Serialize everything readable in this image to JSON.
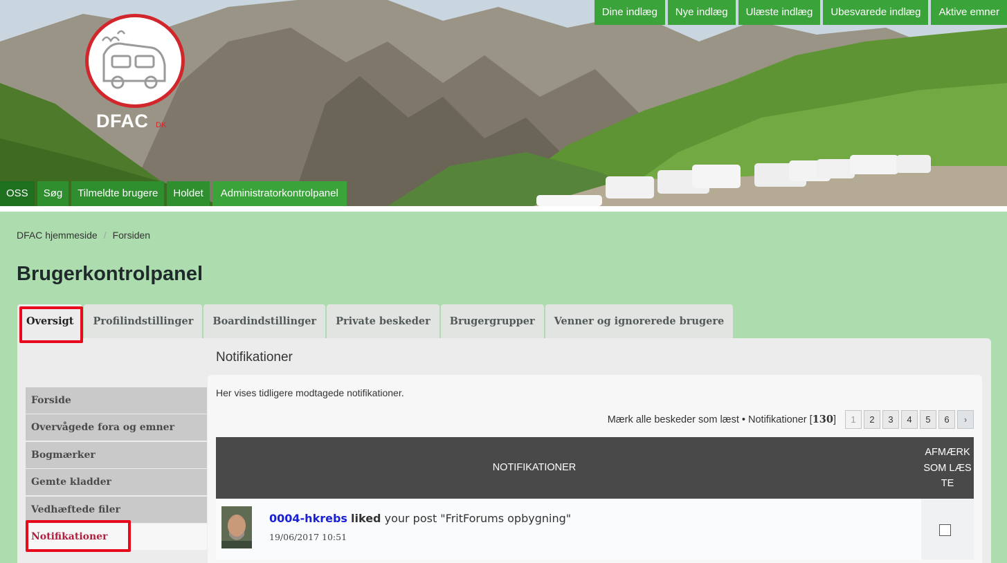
{
  "header": {
    "logo_text": "DFAC",
    "logo_sub": "DK",
    "top_nav": [
      "Dine indlæg",
      "Nye indlæg",
      "Ulæste indlæg",
      "Ubesvarede indlæg",
      "Aktive emner"
    ],
    "bottom_nav": [
      "OSS",
      "Søg",
      "Tilmeldte brugere",
      "Holdet",
      "Administratorkontrolpanel"
    ]
  },
  "breadcrumb": [
    "DFAC hjemmeside",
    "Forsiden"
  ],
  "page_title": "Brugerkontrolpanel",
  "tabs": [
    "Oversigt",
    "Profilindstillinger",
    "Boardindstillinger",
    "Private beskeder",
    "Brugergrupper",
    "Venner og ignorerede brugere"
  ],
  "active_tab": "Oversigt",
  "side_menu": [
    "Forside",
    "Overvågede fora og emner",
    "Bogmærker",
    "Gemte kladder",
    "Vedhæftede filer",
    "Notifikationer"
  ],
  "active_side_item": "Notifikationer",
  "section": {
    "title": "Notifikationer",
    "description": "Her vises tidligere modtagede notifikationer.",
    "mark_all": "Mærk alle beskeder som læst",
    "bullet": "•",
    "count_label": "Notifikationer",
    "count": "130",
    "pages": [
      "1",
      "2",
      "3",
      "4",
      "5",
      "6"
    ],
    "next_glyph": "›"
  },
  "table": {
    "col_notifications": "NOTIFIKATIONER",
    "col_mark": "AFMÆRK SOM LÆSTE",
    "rows": [
      {
        "user": "0004-hkrebs",
        "verb": "liked",
        "rest": "your post \"FritForums opbygning\"",
        "time": "19/06/2017 10:51"
      }
    ]
  },
  "colors": {
    "nav_green": "#3aa33a",
    "page_bg": "#addcae",
    "highlight": "#e8091c",
    "active_link": "#b0203e"
  }
}
